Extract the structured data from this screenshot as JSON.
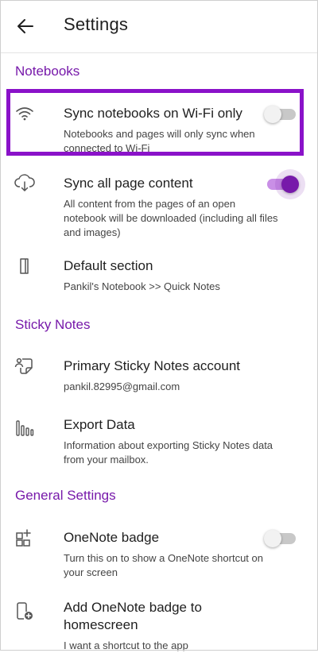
{
  "header": {
    "title": "Settings",
    "back_icon": "arrow-left-icon"
  },
  "colors": {
    "accent": "#7719aa",
    "highlight_box": "#8a12c9",
    "toggle_off_track": "#c8c8c8",
    "toggle_on_track": "#c98fe6"
  },
  "sections": {
    "notebooks": {
      "label": "Notebooks",
      "items": [
        {
          "title": "Sync notebooks on Wi-Fi only",
          "description": "Notebooks and pages will only sync when connected to Wi-Fi",
          "icon": "wifi-icon",
          "toggle": "off"
        },
        {
          "title": "Sync all page content",
          "description": "All content from the pages of an open notebook will be downloaded (including all files and images)",
          "icon": "cloud-download-icon",
          "toggle": "on"
        },
        {
          "title": "Default section",
          "description": "Pankil's Notebook >> Quick Notes",
          "icon": "section-tab-icon"
        }
      ]
    },
    "sticky_notes": {
      "label": "Sticky Notes",
      "items": [
        {
          "title": "Primary Sticky Notes account",
          "description": "pankil.82995@gmail.com",
          "icon": "sticky-note-account-icon"
        },
        {
          "title": "Export Data",
          "description": "Information about exporting Sticky Notes data from your mailbox.",
          "icon": "export-bars-icon"
        }
      ]
    },
    "general": {
      "label": "General Settings",
      "items": [
        {
          "title": "OneNote badge",
          "description": "Turn this on to show a OneNote shortcut on your screen",
          "icon": "grid-plus-icon",
          "toggle": "off"
        },
        {
          "title": "Add OneNote badge to homescreen",
          "description": "I want a shortcut to the app",
          "icon": "phone-add-icon"
        }
      ]
    }
  }
}
